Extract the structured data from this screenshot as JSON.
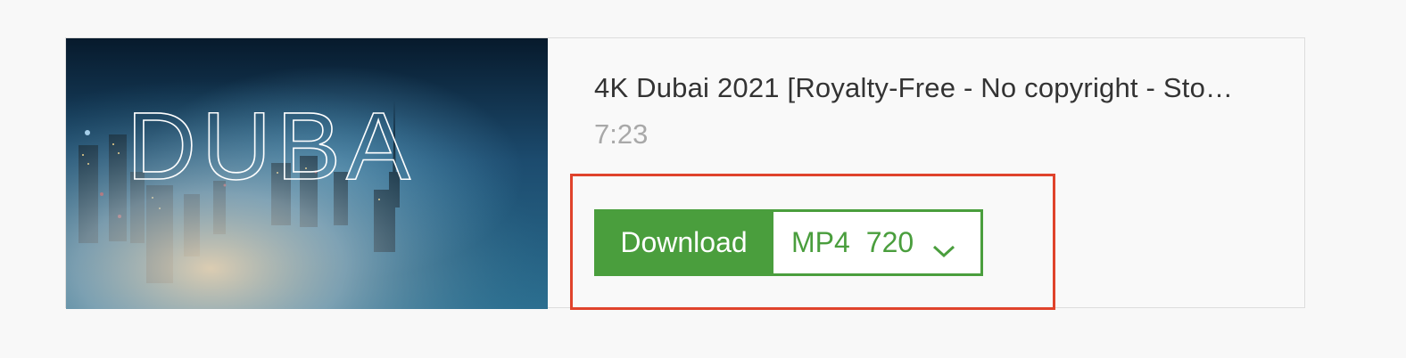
{
  "video": {
    "title": "4K Dubai 2021 [Royalty-Free - No copyright - Sto…",
    "duration": "7:23",
    "thumbnail_text": "DUBA"
  },
  "download": {
    "button_label": "Download",
    "format": "MP4",
    "quality": "720",
    "dropdown_icon": "chevron-down-icon"
  },
  "colors": {
    "accent_green": "#4a9e3d",
    "highlight_red": "#e0432c"
  }
}
